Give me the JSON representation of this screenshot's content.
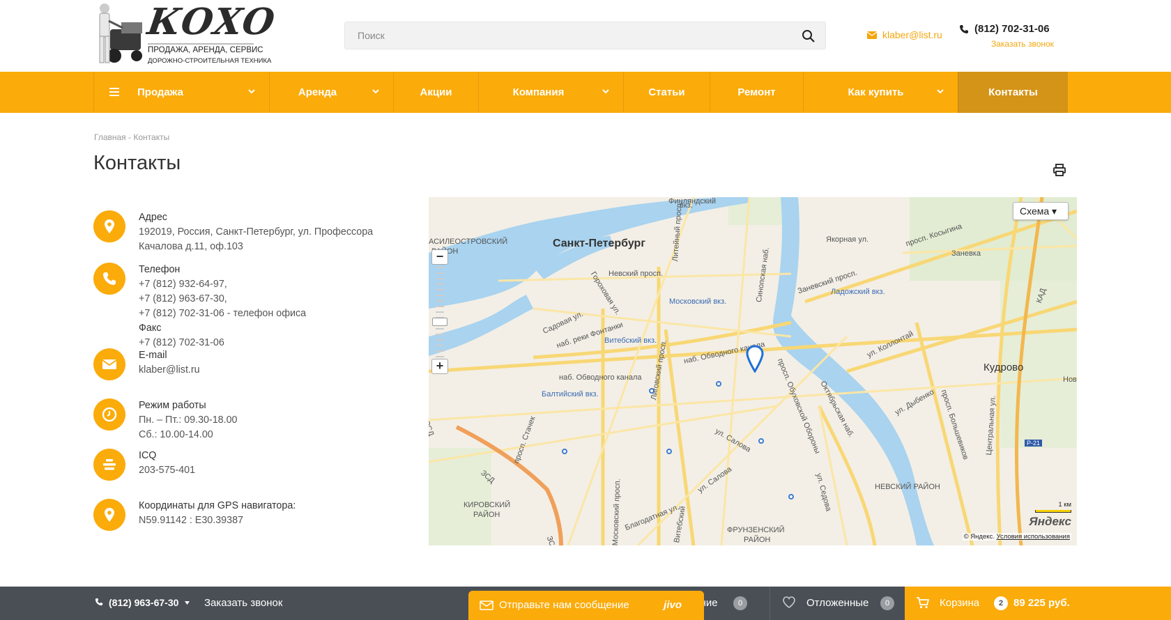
{
  "header": {
    "logo": {
      "brand": "КОХО",
      "line1": "ПРОДАЖА, АРЕНДА, СЕРВИС",
      "line2": "ДОРОЖНО-СТРОИТЕЛЬНАЯ ТЕХНИКА"
    },
    "search_placeholder": "Поиск",
    "email": "klaber@list.ru",
    "phone": "(812) 702-31-06",
    "callback": "Заказать звонок"
  },
  "nav": [
    {
      "label": "Продажа",
      "dropdown": true,
      "menu": true
    },
    {
      "label": "Аренда",
      "dropdown": true
    },
    {
      "label": "Акции",
      "dropdown": false
    },
    {
      "label": "Компания",
      "dropdown": true
    },
    {
      "label": "Статьи",
      "dropdown": false
    },
    {
      "label": "Ремонт",
      "dropdown": false
    },
    {
      "label": "Как купить",
      "dropdown": true
    },
    {
      "label": "Контакты",
      "dropdown": false,
      "active": true
    }
  ],
  "breadcrumbs": {
    "home": "Главная",
    "sep": "-",
    "current": "Контакты"
  },
  "page_title": "Контакты",
  "contacts": {
    "address": {
      "label": "Адрес",
      "line1": "192019, Россия, Санкт-Петербург, ул. Профессора",
      "line2": "Качалова д.11, оф.103"
    },
    "phone": {
      "label": "Телефон",
      "line1": "+7 (812) 932-64-97,",
      "line2": "+7 (812) 963-67-30,",
      "line3": "+7 (812) 702-31-06 - телефон офиса",
      "fax_label": "Факс",
      "fax": "+7 (812) 702-31-06"
    },
    "email": {
      "label": "E-mail",
      "value": "klaber@list.ru"
    },
    "hours": {
      "label": "Режим работы",
      "line1": "Пн. – Пт.: 09.30-18.00",
      "line2": "Сб.: 10.00-14.00"
    },
    "icq": {
      "label": "ICQ",
      "value": "203-575-401"
    },
    "gps": {
      "label": "Координаты для GPS навигатора:",
      "value": "N59.91142 : E30.39387"
    }
  },
  "map": {
    "scheme_label": "Схема",
    "city": "Санкт-Петербург",
    "kudrovo": "Кудрово",
    "labels": {
      "vasilievsky": "АСИЛЕОСТРОВСКИЙ",
      "rayon": "РАЙОН",
      "nevsky": "Невский просп.",
      "liteyny": "Литейный просп.",
      "moskovsky_vkz": "Московский вкз.",
      "vitebsky_vkz": "Витебский вкз.",
      "baltiysky_vkz": "Балтийский вкз.",
      "ladozhsky_vkz": "Ладожский вкз.",
      "sinopskaya": "Синопская наб.",
      "zanevsky": "Заневский просп.",
      "kosygina": "просп. Косыгина",
      "zanevka": "Заневка",
      "yakornaya": "Якорная ул.",
      "obvodny": "наб. Обводного канала",
      "obvodny2": "наб. Обводного канала",
      "sadovaya": "Садовая ул.",
      "gorokhovaya": "Гороховая ул.",
      "fontanka": "наб. реки Фонтанки",
      "ligovsky": "Лиговский просп.",
      "obukhovskoy": "просп. Обуховской Обороны",
      "oktyabrskaya": "Октябрьская наб.",
      "kollontai": "ул. Коллонтай",
      "dybenko": "ул. Дыбенко",
      "bolshevikov": "просп. Большевиков",
      "salova": "ул. Салова",
      "salova2": "ул. Салова",
      "stachek": "просп. Стачек",
      "kirovsky": "КИРОВСКИЙ",
      "kirovsky_r": "РАЙОН",
      "nevsky_rayon": "НЕВСКИЙ РАЙОН",
      "frunzensky": "ФРУНЗЕНСКИЙ",
      "frunzensky_r": "РАЙОН",
      "moskovsky_pr": "Московский просп.",
      "blagodatnaya": "Благодатная ул.",
      "vitebsky_pr": "Витебский",
      "sedova": "ул. Седова",
      "tsentralnaya": "Центральная ул.",
      "zsd": "ЗСД",
      "zsd2": "ЗСД",
      "zsd3": "ЗСД",
      "kad": "КАД",
      "r21": "Р-21",
      "finlyandsky": "Финляндский",
      "vkz": "вкз.",
      "nov": "Нов"
    },
    "scale": "1 км",
    "yandex": "Яндекс",
    "copyright": "© Яндекс",
    "terms": "Условия использования"
  },
  "bottom_bar": {
    "phone": "(812) 963-67-30",
    "callback": "Заказать звонок",
    "compare": "внение",
    "compare_count": "0",
    "deferred": "Отложенные",
    "deferred_count": "0",
    "cart": "Корзина",
    "cart_count": "2",
    "cart_sum": "89 225 руб."
  },
  "jivo": {
    "message": "Отправьте нам сообщение",
    "brand": "jivo"
  },
  "colors": {
    "accent": "#fbab0a",
    "active_nav": "#d49418",
    "bottom_bar": "#4a4f55",
    "link": "#f4a60e"
  }
}
